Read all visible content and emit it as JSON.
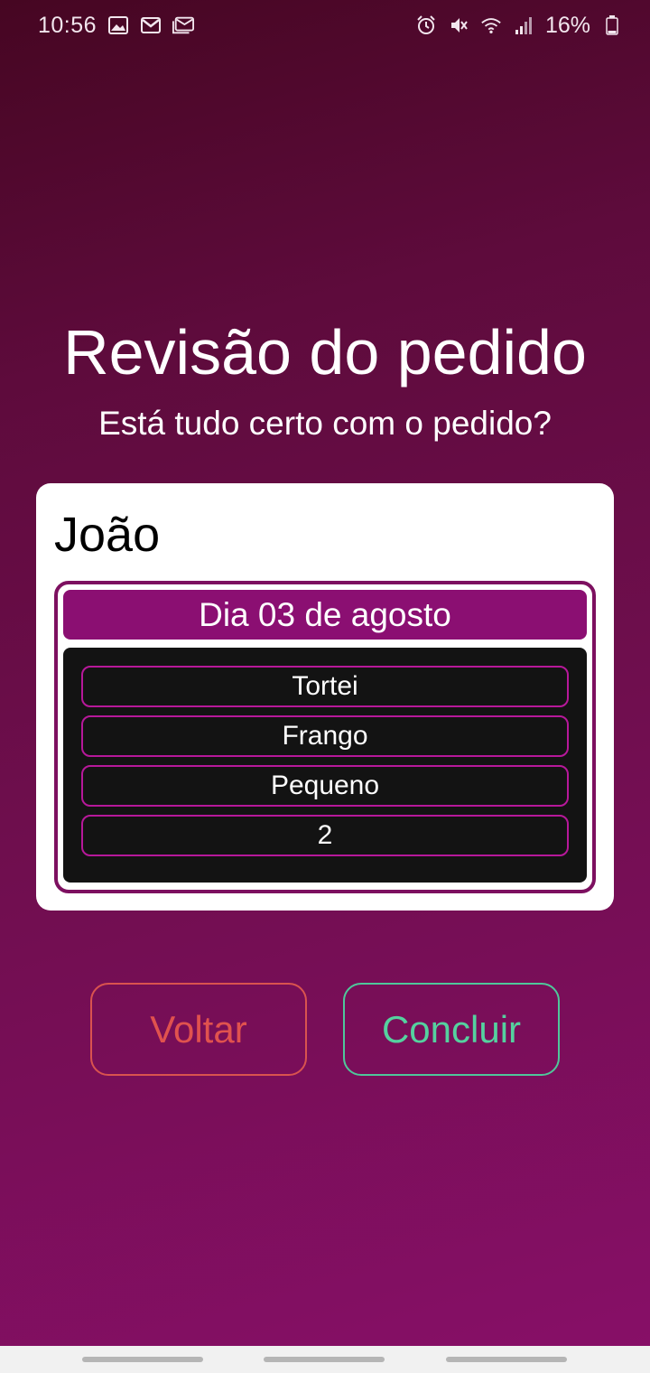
{
  "status_bar": {
    "time": "10:56",
    "battery": "16%",
    "left_icons": [
      "image-icon",
      "gmail-icon",
      "gmail-icon"
    ],
    "right_icons": [
      "alarm-icon",
      "mute-icon",
      "wifi-icon",
      "signal-icon",
      "battery-icon"
    ]
  },
  "header": {
    "title": "Revisão do pedido",
    "subtitle": "Está tudo certo com o pedido?"
  },
  "order": {
    "customer": "João",
    "date": "Dia 03 de agosto",
    "items": [
      "Tortei",
      "Frango",
      "Pequeno",
      "2"
    ]
  },
  "actions": {
    "back_label": "Voltar",
    "done_label": "Concluir"
  },
  "colors": {
    "background_top": "#460622",
    "background_bottom": "#880f68",
    "accent": "#8b0f72",
    "item_border": "#b7189a",
    "back": "#e0524e",
    "done": "#55d19f"
  }
}
